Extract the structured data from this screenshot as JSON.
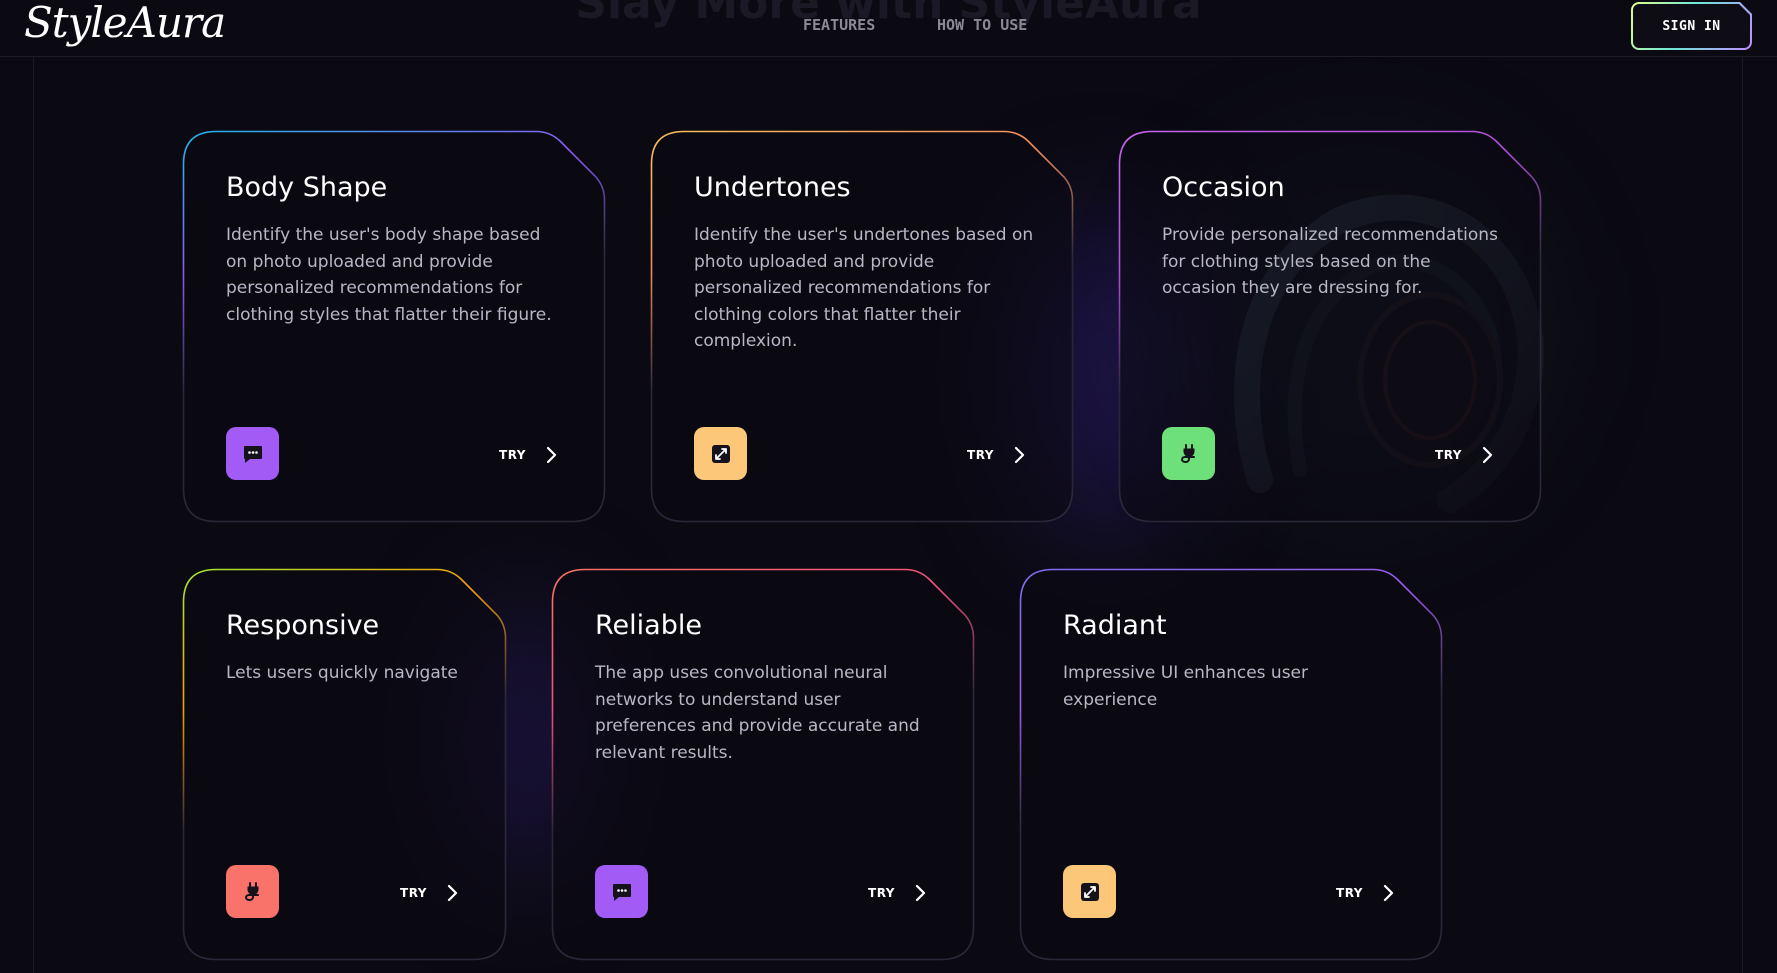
{
  "header": {
    "logo": "StyleAura",
    "ghost_title": "Slay More with StyleAura",
    "nav": [
      {
        "label": "FEATURES"
      },
      {
        "label": "HOW TO USE"
      }
    ],
    "signin_label": "SIGN IN"
  },
  "cards": [
    {
      "title": "Body Shape",
      "description": "Identify the user's body shape based on photo uploaded and provide personalized recommendations for clothing styles that flatter their figure.",
      "icon": "chat-icon",
      "icon_color": "#a25cf5",
      "try_label": "TRY",
      "border_colors": [
        "#22b6f0",
        "#8b5cf6",
        "#2a2838"
      ]
    },
    {
      "title": "Undertones",
      "description": "Identify the user's undertones based on photo uploaded and provide personalized recommendations for clothing colors that flatter their complexion.",
      "icon": "expand-icon",
      "icon_color": "#fdc77a",
      "try_label": "TRY",
      "border_colors": [
        "#fbbf5a",
        "#f08a5d",
        "#2a2838"
      ]
    },
    {
      "title": "Occasion",
      "description": "Provide personalized recommendations for clothing styles based on the occasion they are dressing for.",
      "icon": "plug-icon",
      "icon_color": "#6ee07a",
      "try_label": "TRY",
      "border_colors": [
        "#c865f0",
        "#b04fd8",
        "#2a2838"
      ]
    },
    {
      "title": "Responsive",
      "description": "Lets users quickly navigate",
      "icon": "plug-icon",
      "icon_color": "#f9736b",
      "try_label": "TRY",
      "border_colors": [
        "#a3e635",
        "#f59e0b",
        "#2a2838"
      ]
    },
    {
      "title": "Reliable",
      "description": "The app uses convolutional neural networks to understand user preferences and provide accurate and relevant results.",
      "icon": "chat-icon",
      "icon_color": "#a25cf5",
      "try_label": "TRY",
      "border_colors": [
        "#f97362",
        "#ef4f7a",
        "#2a2838"
      ]
    },
    {
      "title": "Radiant",
      "description": "Impressive UI enhances user experience",
      "icon": "expand-icon",
      "icon_color": "#fdc77a",
      "try_label": "TRY",
      "border_colors": [
        "#7c6cf0",
        "#9d5cf0",
        "#2a2838"
      ]
    }
  ]
}
